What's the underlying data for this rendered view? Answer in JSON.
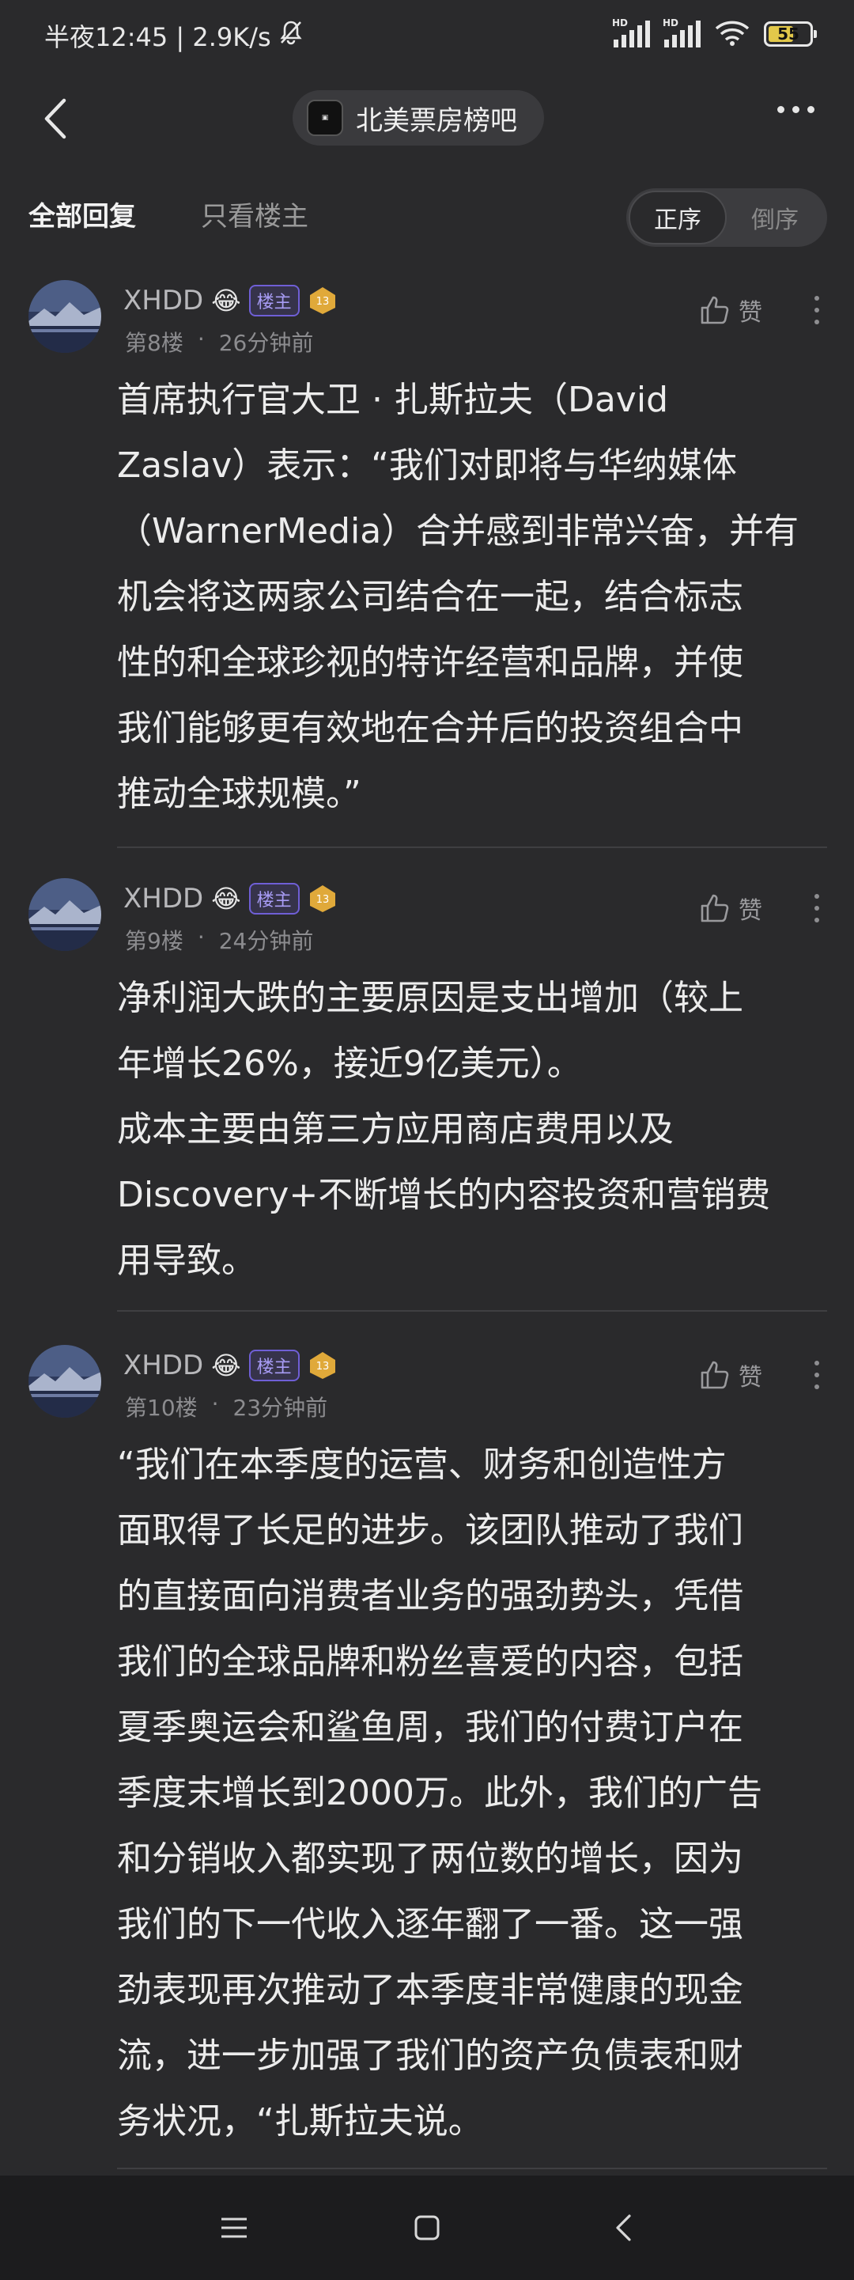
{
  "status_bar": {
    "time_text": "半夜12:45 | 2.9K/s",
    "battery": "55",
    "icons": [
      "bell-muted-icon",
      "signal-hd-icon",
      "signal-hd-icon",
      "wifi-icon",
      "battery-icon"
    ]
  },
  "nav": {
    "forum_name": "北美票房榜吧",
    "icons": [
      "back-arrow-icon",
      "more-dots-icon"
    ]
  },
  "tabs": {
    "all_replies": "全部回复",
    "op_only": "只看楼主",
    "order_asc": "正序",
    "order_desc": "倒序"
  },
  "replies": [
    {
      "username": "XHDD",
      "emoji": "😂",
      "op_badge": "楼主",
      "level": "13",
      "floor": "第8楼",
      "time": "26分钟前",
      "like_label": "赞",
      "text": "首席执行官大卫 · 扎斯拉夫（David\nZaslav）表示：“我们对即将与华纳媒体\n（WarnerMedia）合并感到非常兴奋，并有\n机会将这两家公司结合在一起，结合标志\n性的和全球珍视的特许经营和品牌，并使\n我们能够更有效地在合并后的投资组合中\n推动全球规模。”"
    },
    {
      "username": "XHDD",
      "emoji": "😂",
      "op_badge": "楼主",
      "level": "13",
      "floor": "第9楼",
      "time": "24分钟前",
      "like_label": "赞",
      "text": "净利润大跌的主要原因是支出增加（较上\n年增长26%，接近9亿美元）。\n成本主要由第三方应用商店费用以及\nDiscovery+不断增长的内容投资和营销费\n用导致。"
    },
    {
      "username": "XHDD",
      "emoji": "😂",
      "op_badge": "楼主",
      "level": "13",
      "floor": "第10楼",
      "time": "23分钟前",
      "like_label": "赞",
      "text": "“我们在本季度的运营、财务和创造性方\n面取得了长足的进步。该团队推动了我们\n的直接面向消费者业务的强劲势头，凭借\n我们的全球品牌和粉丝喜爱的内容，包括\n夏季奥运会和鲨鱼周，我们的付费订户在\n季度末增长到2000万。此外，我们的广告\n和分销收入都实现了两位数的增长，因为\n我们的下一代收入逐年翻了一番。这一强\n劲表现再次推动了本季度非常健康的现金\n流，进一步加强了我们的资产负债表和财\n务状况，“扎斯拉夫说。"
    }
  ],
  "system_nav": {
    "icons": [
      "menu-icon",
      "home-square-icon",
      "back-chevron-icon"
    ]
  }
}
